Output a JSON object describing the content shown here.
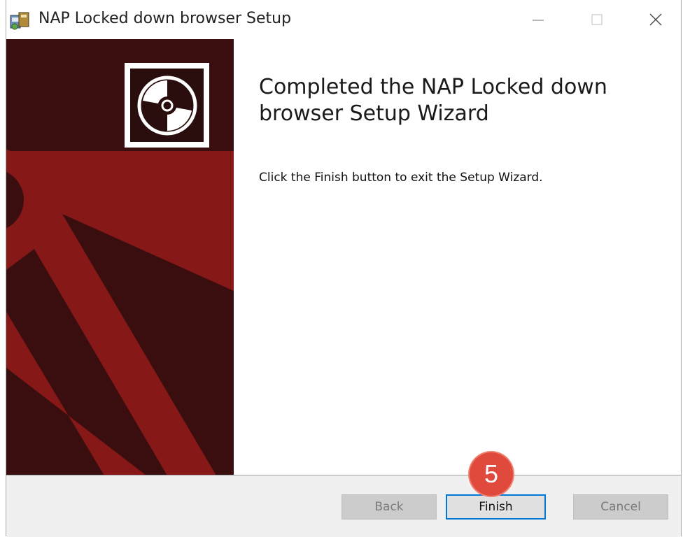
{
  "window": {
    "title": "NAP Locked down browser Setup"
  },
  "content": {
    "heading": "Completed the NAP Locked down browser Setup Wizard",
    "instruction": "Click the Finish button to exit the Setup Wizard."
  },
  "buttons": {
    "back": "Back",
    "finish": "Finish",
    "cancel": "Cancel"
  },
  "annotation": {
    "step_number": "5"
  },
  "colors": {
    "banner_dark": "#3d0f0f",
    "banner_red": "#861818",
    "focus_blue": "#0078d7",
    "badge": "#e04a3c"
  }
}
